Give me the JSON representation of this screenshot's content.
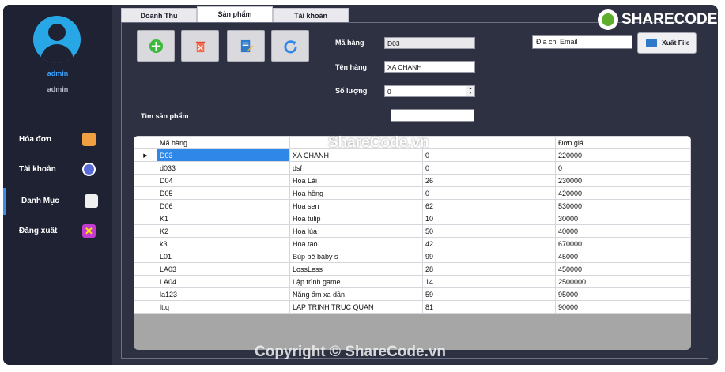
{
  "sidebar": {
    "user_name": "admin",
    "user_role": "admin",
    "items": [
      {
        "label": "Hóa đơn",
        "icon": "invoice-icon",
        "color": "#f0a040"
      },
      {
        "label": "Tài khoản",
        "icon": "account-icon",
        "color": "#5a6bd8"
      },
      {
        "label": "Danh Mục",
        "icon": "catalog-icon",
        "color": "#f0f0f0"
      },
      {
        "label": "Đăng xuất",
        "icon": "logout-icon",
        "color": "#c43bd1"
      }
    ]
  },
  "tabs": [
    {
      "label": "Doanh Thu"
    },
    {
      "label": "Sản phẩm"
    },
    {
      "label": "Tài khoản"
    }
  ],
  "form": {
    "ma_hang_label": "Mã hàng",
    "ma_hang_value": "D03",
    "ten_hang_label": "Tên hàng",
    "ten_hang_value": "XA CHANH",
    "so_luong_label": "Số lượng",
    "so_luong_value": "0",
    "search_label": "Tìm sản phẩm"
  },
  "email_placeholder": "Địa chỉ Email",
  "export_label": "Xuất File",
  "table": {
    "headers": [
      "Mã hàng",
      "",
      "",
      "Đơn giá"
    ],
    "rows": [
      [
        "D03",
        "XA CHANH",
        "0",
        "220000"
      ],
      [
        "d033",
        "dsf",
        "0",
        "0"
      ],
      [
        "D04",
        "Hoa Lài",
        "26",
        "230000"
      ],
      [
        "D05",
        "Hoa hồng",
        "0",
        "420000"
      ],
      [
        "D06",
        "Hoa sen",
        "62",
        "530000"
      ],
      [
        "K1",
        "Hoa tulip",
        "10",
        "30000"
      ],
      [
        "K2",
        "Hoa lúa",
        "50",
        "40000"
      ],
      [
        "k3",
        "Hoa táo",
        "42",
        "670000"
      ],
      [
        "L01",
        "Búp bê baby s",
        "99",
        "45000"
      ],
      [
        "LA03",
        "LossLess",
        "28",
        "450000"
      ],
      [
        "LA04",
        "Lập trình game",
        "14",
        "2500000"
      ],
      [
        "la123",
        "Nắng ấm xa dần",
        "59",
        "95000"
      ],
      [
        "lttq",
        "LAP TRINH TRUC QUAN",
        "81",
        "90000"
      ]
    ]
  },
  "watermark": {
    "center": "ShareCode.vn",
    "bottom": "Copyright © ShareCode.vn",
    "logo": "SHARECODE.vn"
  }
}
